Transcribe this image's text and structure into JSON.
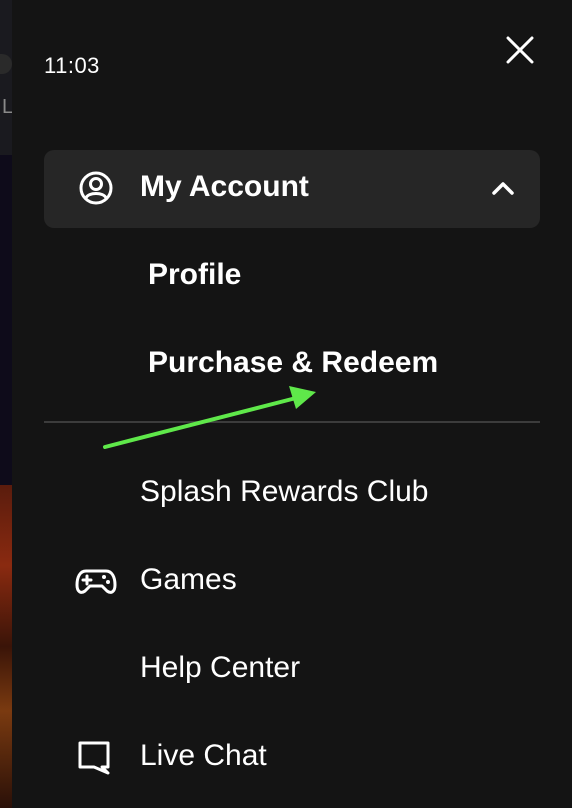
{
  "status": {
    "time": "11:03"
  },
  "backdrop": {
    "stub_text": "L"
  },
  "menu": {
    "account": {
      "label": "My Account",
      "expanded": true,
      "subitems": [
        {
          "label": "Profile"
        },
        {
          "label": "Purchase & Redeem"
        }
      ]
    },
    "items": [
      {
        "label": "Splash Rewards Club",
        "icon": "none"
      },
      {
        "label": "Games",
        "icon": "gamepad-icon"
      },
      {
        "label": "Help Center",
        "icon": "none"
      },
      {
        "label": "Live Chat",
        "icon": "chat-bubble-icon"
      }
    ]
  },
  "colors": {
    "drawer_bg": "#141414",
    "header_bg": "#262626",
    "divider": "#3c3c3c",
    "text": "#ffffff",
    "annotation_arrow": "#5fe84a"
  }
}
